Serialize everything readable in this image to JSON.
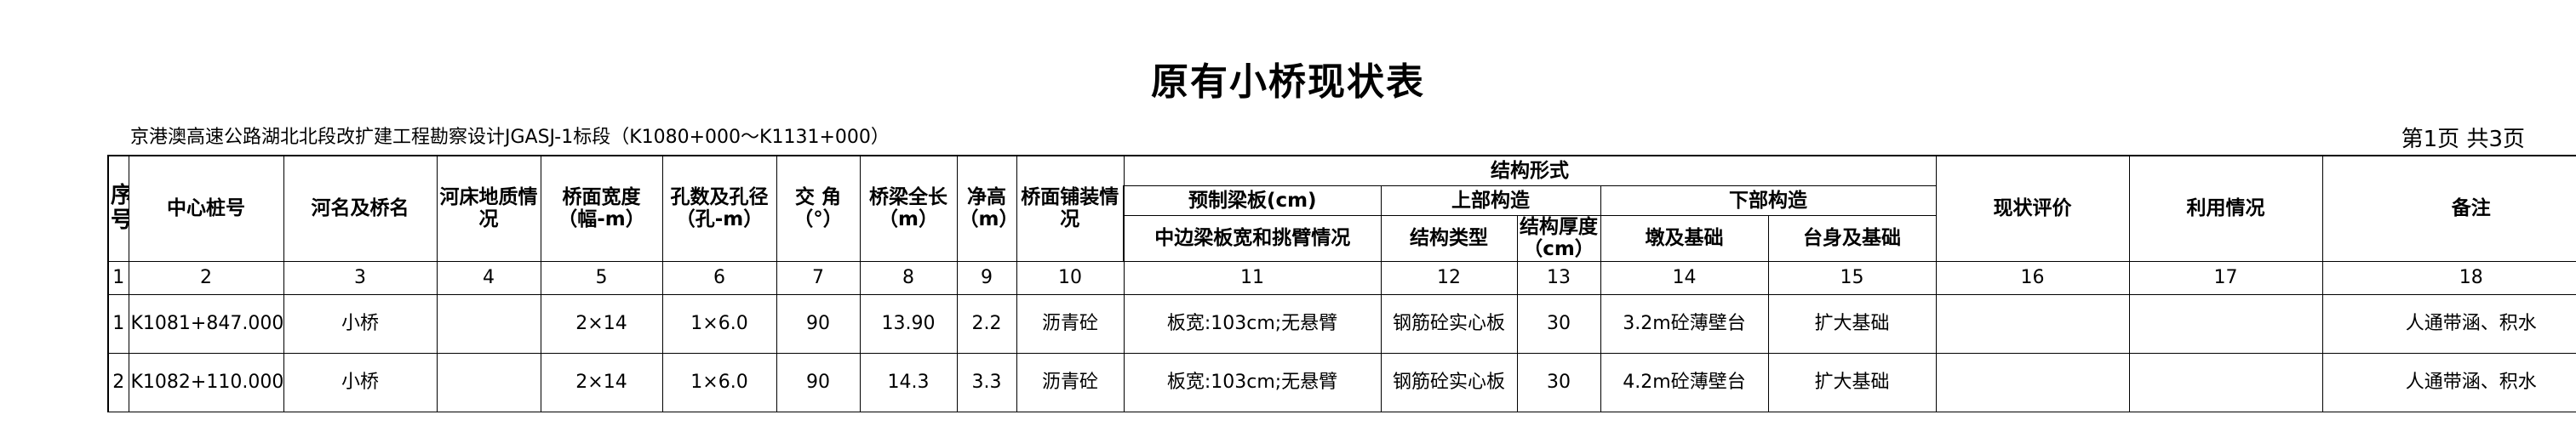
{
  "title": "原有小桥现状表",
  "project": "京港澳高速公路湖北北段改扩建工程勘察设计JGASJ-1标段（K1080+000～K1131+000）",
  "page_info": "第1页 共3页",
  "header": {
    "seq": "序号",
    "center_station": "中心桩号",
    "river_bridge_name": "河名及桥名",
    "riverbed_geology": "河床地质情况",
    "deck_width": "桥面宽度（幅-m）",
    "spans": "孔数及孔径（孔-m）",
    "skew_angle": "交 角（°）",
    "bridge_length": "桥梁全长（m）",
    "clear_height": "净高（m）",
    "deck_pavement": "桥面铺装情况",
    "structure_form": "结构形式",
    "precast_slab": "预制梁板(cm)",
    "superstructure": "上部构造",
    "substructure": "下部构造",
    "slab_width_cantilever": "中边梁板宽和挑臂情况",
    "structure_type": "结构类型",
    "structure_thickness": "结构厚度（cm）",
    "pier_foundation": "墩及基础",
    "abutment_foundation": "台身及基础",
    "current_evaluation": "现状评价",
    "utilization": "利用情况",
    "remarks": "备注"
  },
  "column_numbers": [
    "1",
    "2",
    "3",
    "4",
    "5",
    "6",
    "7",
    "8",
    "9",
    "10",
    "11",
    "12",
    "13",
    "14",
    "15",
    "16",
    "17",
    "18"
  ],
  "rows": [
    {
      "seq": "1",
      "station": "K1081+847.000",
      "name": "小桥",
      "geology": "",
      "width": "2×14",
      "spans": "1×6.0",
      "angle": "90",
      "length": "13.90",
      "clear": "2.2",
      "pavement": "沥青砼",
      "slab": "板宽:103cm;无悬臂",
      "type": "钢筋砼实心板",
      "thickness": "30",
      "pier": "3.2m砼薄壁台",
      "abutment": "扩大基础",
      "evaluation": "",
      "utilization": "",
      "remarks": "人通带涵、积水"
    },
    {
      "seq": "2",
      "station": "K1082+110.000",
      "name": "小桥",
      "geology": "",
      "width": "2×14",
      "spans": "1×6.0",
      "angle": "90",
      "length": "14.3",
      "clear": "3.3",
      "pavement": "沥青砼",
      "slab": "板宽:103cm;无悬臂",
      "type": "钢筋砼实心板",
      "thickness": "30",
      "pier": "4.2m砼薄壁台",
      "abutment": "扩大基础",
      "evaluation": "",
      "utilization": "",
      "remarks": "人通带涵、积水"
    }
  ]
}
